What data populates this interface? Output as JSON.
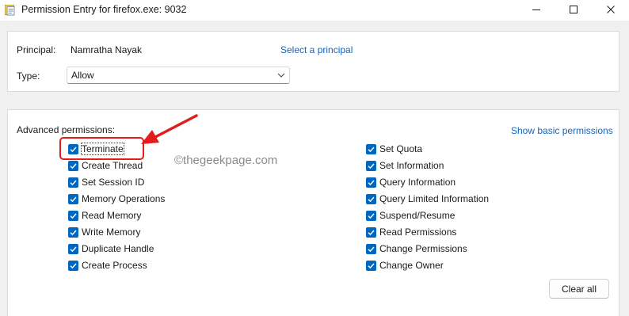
{
  "window": {
    "title": "Permission Entry for firefox.exe: 9032"
  },
  "principal": {
    "label": "Principal:",
    "value": "Namratha Nayak",
    "select_link": "Select a principal"
  },
  "type": {
    "label": "Type:",
    "selected": "Allow"
  },
  "advanced": {
    "heading": "Advanced permissions:",
    "show_basic_link": "Show basic permissions",
    "left_column": [
      {
        "label": "Terminate",
        "checked": true
      },
      {
        "label": "Create Thread",
        "checked": true
      },
      {
        "label": "Set Session ID",
        "checked": true
      },
      {
        "label": "Memory Operations",
        "checked": true
      },
      {
        "label": "Read Memory",
        "checked": true
      },
      {
        "label": "Write Memory",
        "checked": true
      },
      {
        "label": "Duplicate Handle",
        "checked": true
      },
      {
        "label": "Create Process",
        "checked": true
      }
    ],
    "right_column": [
      {
        "label": "Set Quota",
        "checked": true
      },
      {
        "label": "Set Information",
        "checked": true
      },
      {
        "label": "Query Information",
        "checked": true
      },
      {
        "label": "Query Limited Information",
        "checked": true
      },
      {
        "label": "Suspend/Resume",
        "checked": true
      },
      {
        "label": "Read Permissions",
        "checked": true
      },
      {
        "label": "Change Permissions",
        "checked": true
      },
      {
        "label": "Change Owner",
        "checked": true
      }
    ],
    "clear_all_label": "Clear all"
  },
  "watermark": "©thegeekpage.com",
  "colors": {
    "checkbox": "#0067c0",
    "link": "#1565c0",
    "annotation": "#e21c1c"
  }
}
